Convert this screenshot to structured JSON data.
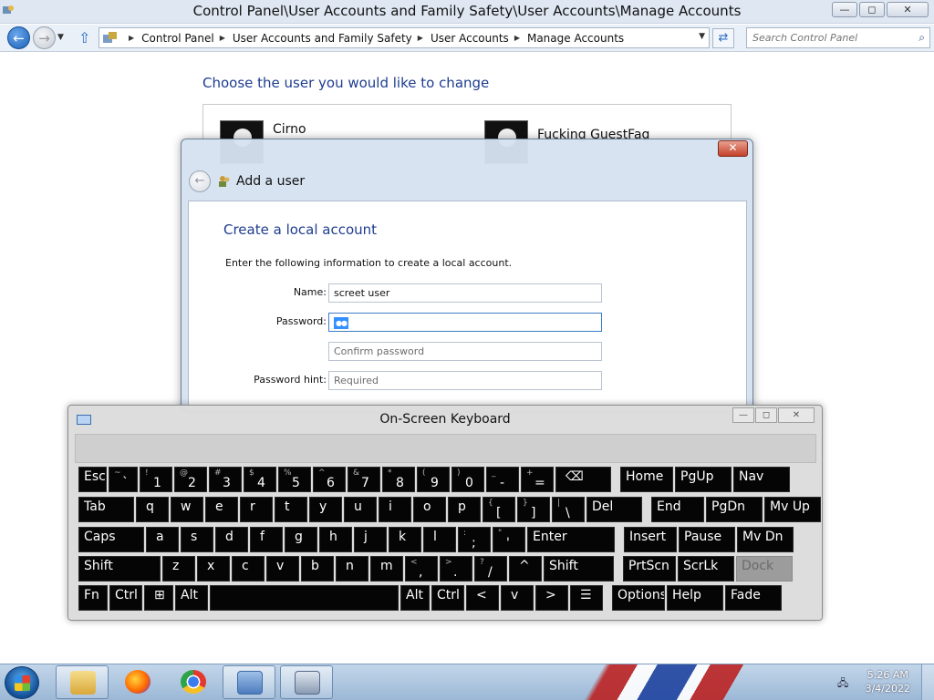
{
  "window": {
    "title": "Control Panel\\User Accounts and Family Safety\\User Accounts\\Manage Accounts",
    "minimize": "—",
    "maximize": "◻",
    "close": "✕"
  },
  "navigation": {
    "breadcrumb": [
      "Control Panel",
      "User Accounts and Family Safety",
      "User Accounts",
      "Manage Accounts"
    ],
    "search_placeholder": "Search Control Panel"
  },
  "main": {
    "heading": "Choose the user you would like to change",
    "users": [
      {
        "name": "Cirno"
      },
      {
        "name": "Fucking GuestFag"
      }
    ]
  },
  "dialog": {
    "title": "Add a user",
    "subtitle": "Create a local account",
    "intro": "Enter the following information to create a local account.",
    "close": "✕",
    "fields": {
      "name_label": "Name:",
      "name_value": "screet user",
      "password_label": "Password:",
      "password_value": "●●",
      "confirm_placeholder": "Confirm password",
      "hint_label": "Password hint:",
      "hint_placeholder": "Required"
    }
  },
  "osk": {
    "title": "On-Screen Keyboard",
    "rows": [
      [
        "Esc",
        "`",
        "1",
        "2",
        "3",
        "4",
        "5",
        "6",
        "7",
        "8",
        "9",
        "0",
        "-",
        "=",
        "⌫",
        "Home",
        "PgUp",
        "Nav"
      ],
      [
        "Tab",
        "q",
        "w",
        "e",
        "r",
        "t",
        "y",
        "u",
        "i",
        "o",
        "p",
        "[",
        "]",
        "\\",
        "Del",
        "End",
        "PgDn",
        "Mv Up"
      ],
      [
        "Caps",
        "a",
        "s",
        "d",
        "f",
        "g",
        "h",
        "j",
        "k",
        "l",
        ";",
        "'",
        "Enter",
        "Insert",
        "Pause",
        "Mv Dn"
      ],
      [
        "Shift",
        "z",
        "x",
        "c",
        "v",
        "b",
        "n",
        "m",
        ",",
        ".",
        "/",
        "^",
        "Shift",
        "PrtScn",
        "ScrLk",
        "Dock"
      ],
      [
        "Fn",
        "Ctrl",
        "⊞",
        "Alt",
        "",
        "Alt",
        "Ctrl",
        "<",
        "v",
        ">",
        "☰",
        "Options",
        "Help",
        "Fade"
      ]
    ],
    "shift_symbols": {
      "1": "!",
      "2": "@",
      "3": "#",
      "4": "$",
      "5": "%",
      "6": "^",
      "7": "&",
      "8": "*",
      "9": "(",
      "0": ")",
      "-": "_",
      "=": "+",
      "[": "{",
      "]": "}",
      "\\": "|",
      ";": ":",
      "'": "\"",
      ",": "<",
      ".": ">",
      "/": "?",
      "`": "~"
    }
  },
  "taskbar": {
    "apps": [
      "folder-icon",
      "firefox-icon",
      "chrome-icon",
      "control-panel-icon",
      "on-screen-keyboard-icon"
    ],
    "time": "5:26 AM",
    "date": "3/4/2022"
  }
}
